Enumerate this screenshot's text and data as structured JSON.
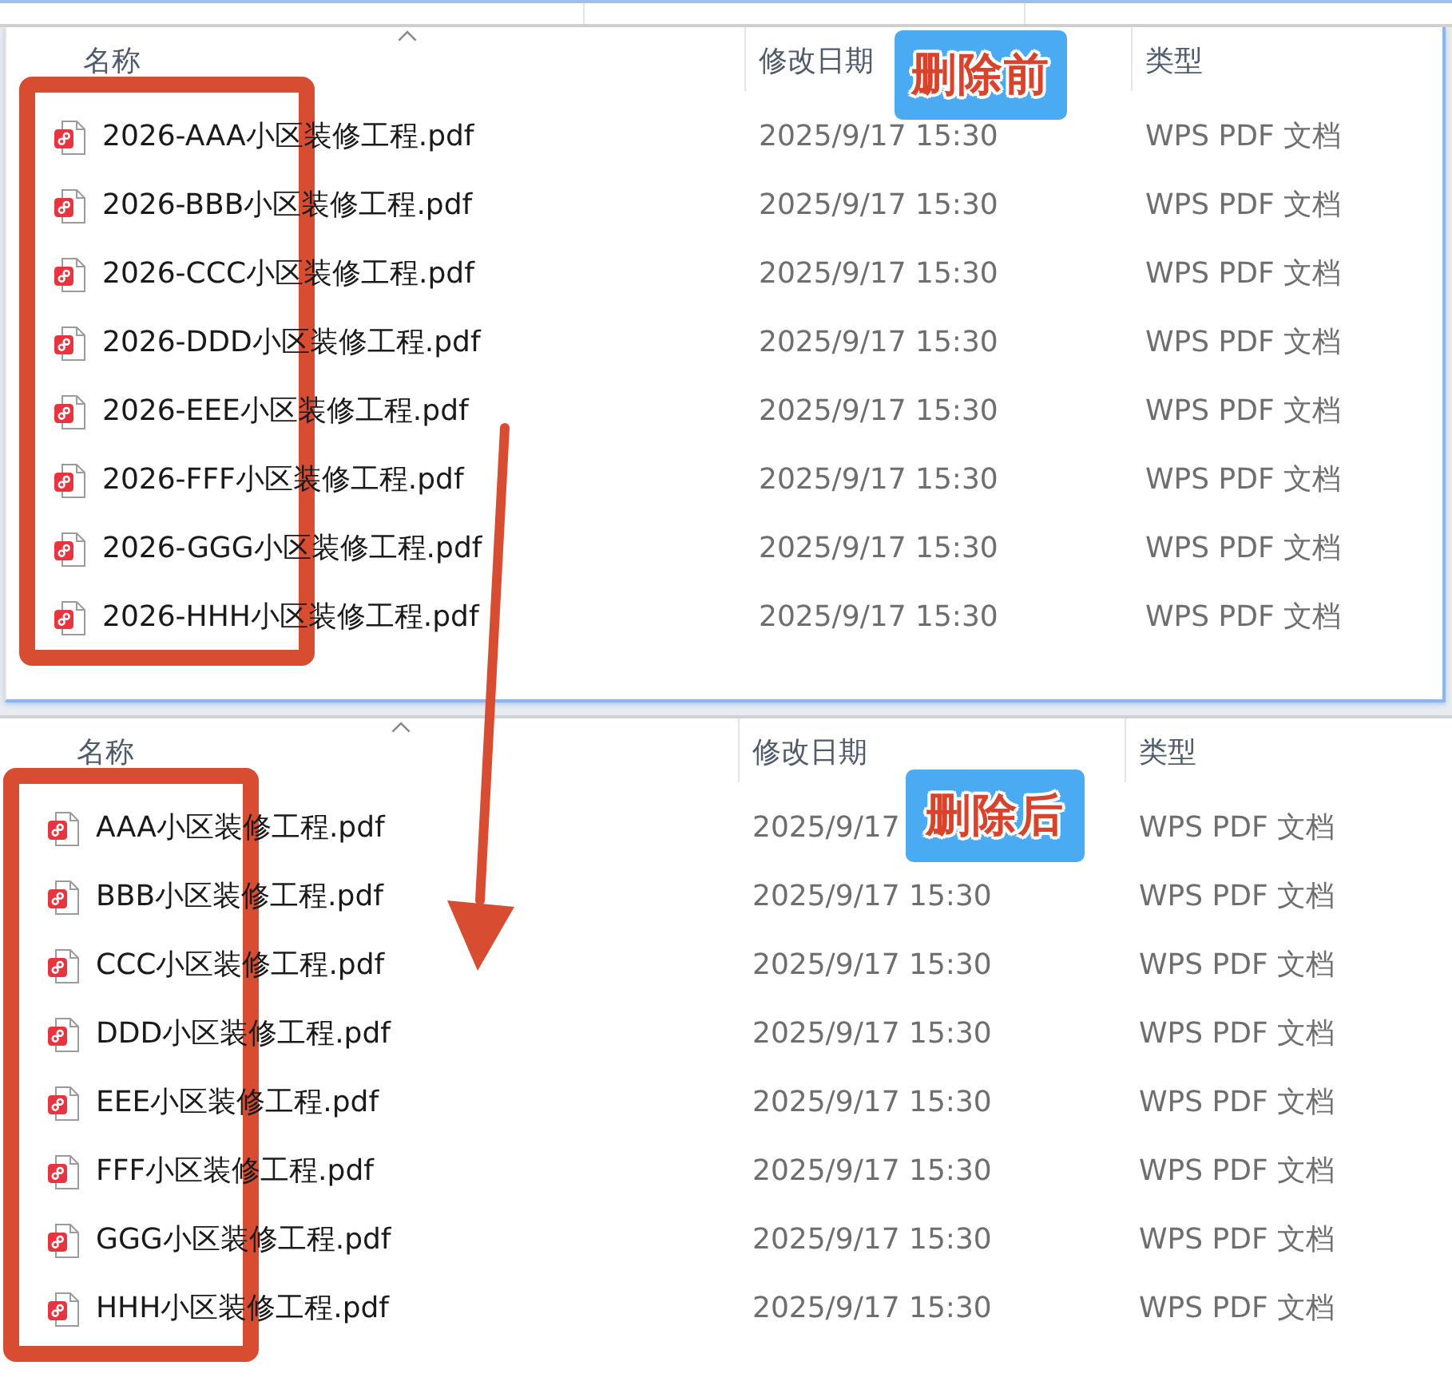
{
  "panels": [
    {
      "caption": "删除前",
      "columns": [
        {
          "label": "名称",
          "sorted": true
        },
        {
          "label": "修改日期",
          "sorted": false
        },
        {
          "label": "类型",
          "sorted": false
        }
      ],
      "files": [
        {
          "name": "2026-AAA小区装修工程.pdf",
          "modified": "2025/9/17 15:30",
          "type": "WPS PDF 文档"
        },
        {
          "name": "2026-BBB小区装修工程.pdf",
          "modified": "2025/9/17 15:30",
          "type": "WPS PDF 文档"
        },
        {
          "name": "2026-CCC小区装修工程.pdf",
          "modified": "2025/9/17 15:30",
          "type": "WPS PDF 文档"
        },
        {
          "name": "2026-DDD小区装修工程.pdf",
          "modified": "2025/9/17 15:30",
          "type": "WPS PDF 文档"
        },
        {
          "name": "2026-EEE小区装修工程.pdf",
          "modified": "2025/9/17 15:30",
          "type": "WPS PDF 文档"
        },
        {
          "name": "2026-FFF小区装修工程.pdf",
          "modified": "2025/9/17 15:30",
          "type": "WPS PDF 文档"
        },
        {
          "name": "2026-GGG小区装修工程.pdf",
          "modified": "2025/9/17 15:30",
          "type": "WPS PDF 文档"
        },
        {
          "name": "2026-HHH小区装修工程.pdf",
          "modified": "2025/9/17 15:30",
          "type": "WPS PDF 文档"
        }
      ]
    },
    {
      "caption": "删除后",
      "columns": [
        {
          "label": "名称",
          "sorted": true
        },
        {
          "label": "修改日期",
          "sorted": false
        },
        {
          "label": "类型",
          "sorted": false
        }
      ],
      "files": [
        {
          "name": "AAA小区装修工程.pdf",
          "modified": "2025/9/17",
          "type": "WPS PDF 文档"
        },
        {
          "name": "BBB小区装修工程.pdf",
          "modified": "2025/9/17 15:30",
          "type": "WPS PDF 文档"
        },
        {
          "name": "CCC小区装修工程.pdf",
          "modified": "2025/9/17 15:30",
          "type": "WPS PDF 文档"
        },
        {
          "name": "DDD小区装修工程.pdf",
          "modified": "2025/9/17 15:30",
          "type": "WPS PDF 文档"
        },
        {
          "name": "EEE小区装修工程.pdf",
          "modified": "2025/9/17 15:30",
          "type": "WPS PDF 文档"
        },
        {
          "name": "FFF小区装修工程.pdf",
          "modified": "2025/9/17 15:30",
          "type": "WPS PDF 文档"
        },
        {
          "name": "GGG小区装修工程.pdf",
          "modified": "2025/9/17 15:30",
          "type": "WPS PDF 文档"
        },
        {
          "name": "HHH小区装修工程.pdf",
          "modified": "2025/9/17 15:30",
          "type": "WPS PDF 文档"
        }
      ]
    }
  ]
}
